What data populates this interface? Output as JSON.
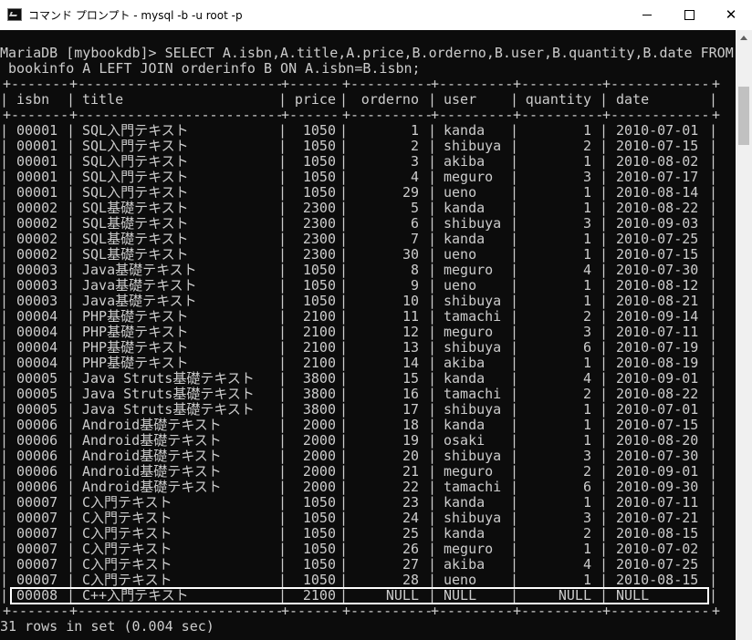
{
  "window": {
    "title": "コマンド プロンプト - mysql  -b -u root -p",
    "controls": {
      "minimize": "—",
      "maximize": "□",
      "close": "✕"
    }
  },
  "console": {
    "command_line_1": "MariaDB [mybookdb]> SELECT A.isbn,A.title,A.price,B.orderno,B.user,B.quantity,B.date FROM",
    "command_line_2": " bookinfo A LEFT JOIN orderinfo B ON A.isbn=B.isbn;",
    "headers": [
      "isbn",
      "title",
      "price",
      "orderno",
      "user",
      "quantity",
      "date"
    ],
    "rows": [
      [
        "00001",
        "SQL入門テキスト",
        "1050",
        "1",
        "kanda",
        "1",
        "2010-07-01"
      ],
      [
        "00001",
        "SQL入門テキスト",
        "1050",
        "2",
        "shibuya",
        "2",
        "2010-07-15"
      ],
      [
        "00001",
        "SQL入門テキスト",
        "1050",
        "3",
        "akiba",
        "1",
        "2010-08-02"
      ],
      [
        "00001",
        "SQL入門テキスト",
        "1050",
        "4",
        "meguro",
        "3",
        "2010-07-17"
      ],
      [
        "00001",
        "SQL入門テキスト",
        "1050",
        "29",
        "ueno",
        "1",
        "2010-08-14"
      ],
      [
        "00002",
        "SQL基礎テキスト",
        "2300",
        "5",
        "kanda",
        "1",
        "2010-08-22"
      ],
      [
        "00002",
        "SQL基礎テキスト",
        "2300",
        "6",
        "shibuya",
        "3",
        "2010-09-03"
      ],
      [
        "00002",
        "SQL基礎テキスト",
        "2300",
        "7",
        "kanda",
        "1",
        "2010-07-25"
      ],
      [
        "00002",
        "SQL基礎テキスト",
        "2300",
        "30",
        "ueno",
        "1",
        "2010-07-15"
      ],
      [
        "00003",
        "Java基礎テキスト",
        "1050",
        "8",
        "meguro",
        "4",
        "2010-07-30"
      ],
      [
        "00003",
        "Java基礎テキスト",
        "1050",
        "9",
        "ueno",
        "1",
        "2010-08-12"
      ],
      [
        "00003",
        "Java基礎テキスト",
        "1050",
        "10",
        "shibuya",
        "1",
        "2010-08-21"
      ],
      [
        "00004",
        "PHP基礎テキスト",
        "2100",
        "11",
        "tamachi",
        "2",
        "2010-09-14"
      ],
      [
        "00004",
        "PHP基礎テキスト",
        "2100",
        "12",
        "meguro",
        "3",
        "2010-07-11"
      ],
      [
        "00004",
        "PHP基礎テキスト",
        "2100",
        "13",
        "shibuya",
        "6",
        "2010-07-19"
      ],
      [
        "00004",
        "PHP基礎テキスト",
        "2100",
        "14",
        "akiba",
        "1",
        "2010-08-19"
      ],
      [
        "00005",
        "Java Struts基礎テキスト",
        "3800",
        "15",
        "kanda",
        "4",
        "2010-09-01"
      ],
      [
        "00005",
        "Java Struts基礎テキスト",
        "3800",
        "16",
        "tamachi",
        "2",
        "2010-08-22"
      ],
      [
        "00005",
        "Java Struts基礎テキスト",
        "3800",
        "17",
        "shibuya",
        "1",
        "2010-07-01"
      ],
      [
        "00006",
        "Android基礎テキスト",
        "2000",
        "18",
        "kanda",
        "1",
        "2010-07-15"
      ],
      [
        "00006",
        "Android基礎テキスト",
        "2000",
        "19",
        "osaki",
        "1",
        "2010-08-20"
      ],
      [
        "00006",
        "Android基礎テキスト",
        "2000",
        "20",
        "shibuya",
        "3",
        "2010-07-30"
      ],
      [
        "00006",
        "Android基礎テキスト",
        "2000",
        "21",
        "meguro",
        "2",
        "2010-09-01"
      ],
      [
        "00006",
        "Android基礎テキスト",
        "2000",
        "22",
        "tamachi",
        "6",
        "2010-09-30"
      ],
      [
        "00007",
        "C入門テキスト",
        "1050",
        "23",
        "kanda",
        "1",
        "2010-07-11"
      ],
      [
        "00007",
        "C入門テキスト",
        "1050",
        "24",
        "shibuya",
        "3",
        "2010-07-21"
      ],
      [
        "00007",
        "C入門テキスト",
        "1050",
        "25",
        "kanda",
        "2",
        "2010-08-15"
      ],
      [
        "00007",
        "C入門テキスト",
        "1050",
        "26",
        "meguro",
        "1",
        "2010-07-02"
      ],
      [
        "00007",
        "C入門テキスト",
        "1050",
        "27",
        "akiba",
        "4",
        "2010-07-25"
      ],
      [
        "00007",
        "C入門テキスト",
        "1050",
        "28",
        "ueno",
        "1",
        "2010-08-15"
      ],
      [
        "00008",
        "C++入門テキスト",
        "2100",
        "NULL",
        "NULL",
        "NULL",
        "NULL"
      ]
    ],
    "result_summary": "31 rows in set (0.004 sec)",
    "highlighted_row_index": 30
  },
  "colors": {
    "background": "#0c0c0c",
    "text": "#cccccc",
    "highlight_border": "#ffffff",
    "titlebar": "#ffffff"
  }
}
